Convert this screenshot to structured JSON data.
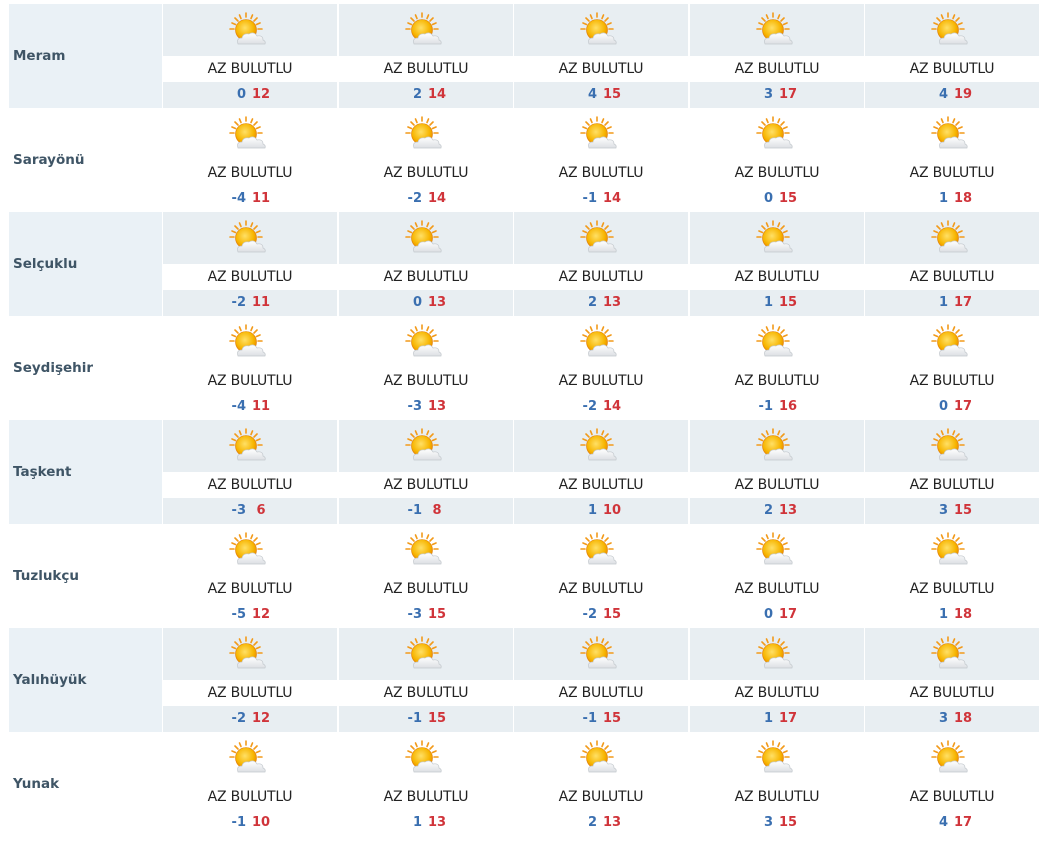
{
  "colors": {
    "shaded": "#e8eef2",
    "city_text": "#3f5566",
    "min_temp": "#3a6fb0",
    "max_temp": "#d0343a"
  },
  "icon": "partly-sunny-icon",
  "cities": [
    {
      "name": "Meram",
      "days": [
        {
          "condition": "AZ BULUTLU",
          "min": "0",
          "max": "12"
        },
        {
          "condition": "AZ BULUTLU",
          "min": "2",
          "max": "14"
        },
        {
          "condition": "AZ BULUTLU",
          "min": "4",
          "max": "15"
        },
        {
          "condition": "AZ BULUTLU",
          "min": "3",
          "max": "17"
        },
        {
          "condition": "AZ BULUTLU",
          "min": "4",
          "max": "19"
        }
      ]
    },
    {
      "name": "Sarayönü",
      "days": [
        {
          "condition": "AZ BULUTLU",
          "min": "-4",
          "max": "11"
        },
        {
          "condition": "AZ BULUTLU",
          "min": "-2",
          "max": "14"
        },
        {
          "condition": "AZ BULUTLU",
          "min": "-1",
          "max": "14"
        },
        {
          "condition": "AZ BULUTLU",
          "min": "0",
          "max": "15"
        },
        {
          "condition": "AZ BULUTLU",
          "min": "1",
          "max": "18"
        }
      ]
    },
    {
      "name": "Selçuklu",
      "days": [
        {
          "condition": "AZ BULUTLU",
          "min": "-2",
          "max": "11"
        },
        {
          "condition": "AZ BULUTLU",
          "min": "0",
          "max": "13"
        },
        {
          "condition": "AZ BULUTLU",
          "min": "2",
          "max": "13"
        },
        {
          "condition": "AZ BULUTLU",
          "min": "1",
          "max": "15"
        },
        {
          "condition": "AZ BULUTLU",
          "min": "1",
          "max": "17"
        }
      ]
    },
    {
      "name": "Seydişehir",
      "days": [
        {
          "condition": "AZ BULUTLU",
          "min": "-4",
          "max": "11"
        },
        {
          "condition": "AZ BULUTLU",
          "min": "-3",
          "max": "13"
        },
        {
          "condition": "AZ BULUTLU",
          "min": "-2",
          "max": "14"
        },
        {
          "condition": "AZ BULUTLU",
          "min": "-1",
          "max": "16"
        },
        {
          "condition": "AZ BULUTLU",
          "min": "0",
          "max": "17"
        }
      ]
    },
    {
      "name": "Taşkent",
      "days": [
        {
          "condition": "AZ BULUTLU",
          "min": "-3",
          "max": "6"
        },
        {
          "condition": "AZ BULUTLU",
          "min": "-1",
          "max": "8"
        },
        {
          "condition": "AZ BULUTLU",
          "min": "1",
          "max": "10"
        },
        {
          "condition": "AZ BULUTLU",
          "min": "2",
          "max": "13"
        },
        {
          "condition": "AZ BULUTLU",
          "min": "3",
          "max": "15"
        }
      ]
    },
    {
      "name": "Tuzlukçu",
      "days": [
        {
          "condition": "AZ BULUTLU",
          "min": "-5",
          "max": "12"
        },
        {
          "condition": "AZ BULUTLU",
          "min": "-3",
          "max": "15"
        },
        {
          "condition": "AZ BULUTLU",
          "min": "-2",
          "max": "15"
        },
        {
          "condition": "AZ BULUTLU",
          "min": "0",
          "max": "17"
        },
        {
          "condition": "AZ BULUTLU",
          "min": "1",
          "max": "18"
        }
      ]
    },
    {
      "name": "Yalıhüyük",
      "days": [
        {
          "condition": "AZ BULUTLU",
          "min": "-2",
          "max": "12"
        },
        {
          "condition": "AZ BULUTLU",
          "min": "-1",
          "max": "15"
        },
        {
          "condition": "AZ BULUTLU",
          "min": "-1",
          "max": "15"
        },
        {
          "condition": "AZ BULUTLU",
          "min": "1",
          "max": "17"
        },
        {
          "condition": "AZ BULUTLU",
          "min": "3",
          "max": "18"
        }
      ]
    },
    {
      "name": "Yunak",
      "days": [
        {
          "condition": "AZ BULUTLU",
          "min": "-1",
          "max": "10"
        },
        {
          "condition": "AZ BULUTLU",
          "min": "1",
          "max": "13"
        },
        {
          "condition": "AZ BULUTLU",
          "min": "2",
          "max": "13"
        },
        {
          "condition": "AZ BULUTLU",
          "min": "3",
          "max": "15"
        },
        {
          "condition": "AZ BULUTLU",
          "min": "4",
          "max": "17"
        }
      ]
    }
  ]
}
